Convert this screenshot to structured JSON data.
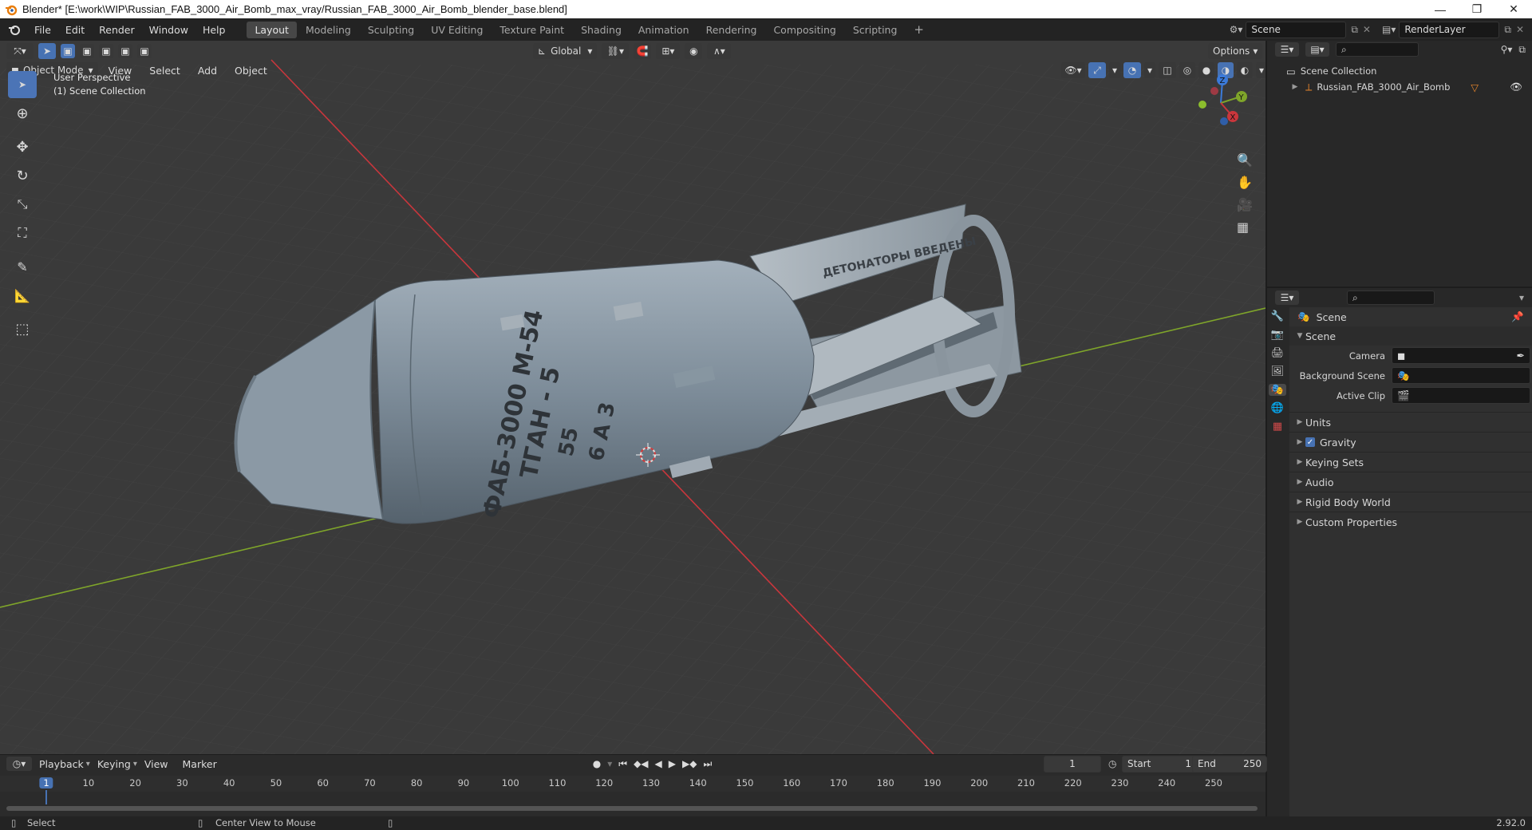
{
  "window": {
    "title": "Blender* [E:\\work\\WIP\\Russian_FAB_3000_Air_Bomb_max_vray/Russian_FAB_3000_Air_Bomb_blender_base.blend]",
    "minimize": "—",
    "maximize": "❐",
    "close": "✕"
  },
  "menu": [
    "File",
    "Edit",
    "Render",
    "Window",
    "Help"
  ],
  "workspaces": [
    "Layout",
    "Modeling",
    "Sculpting",
    "UV Editing",
    "Texture Paint",
    "Shading",
    "Animation",
    "Rendering",
    "Compositing",
    "Scripting"
  ],
  "add_workspace": "+",
  "scene_field": "Scene",
  "renderlayer_field": "RenderLayer",
  "viewport": {
    "mode": "Object Mode",
    "view_menu": "View",
    "select_menu": "Select",
    "add_menu": "Add",
    "object_menu": "Object",
    "orientation": "Global",
    "options": "Options",
    "overlay_line1": "User Perspective",
    "overlay_line2": "(1) Scene Collection",
    "gizmo": {
      "z": "Z",
      "y": "Y",
      "x": "X"
    },
    "model_text": {
      "line1": "ФАБ-3000 М-54",
      "line2": "ТГАН - 5",
      "line3": "55",
      "line4": "6 А 3",
      "tail": "ДЕТОНАТОРЫ ВВЕДЕНЫ"
    }
  },
  "timeline": {
    "menus": [
      "Playback",
      "Keying",
      "View",
      "Marker"
    ],
    "current_frame": "1",
    "start_label": "Start",
    "start_value": "1",
    "end_label": "End",
    "end_value": "250",
    "ruler": [
      "1",
      "10",
      "20",
      "30",
      "40",
      "50",
      "60",
      "70",
      "80",
      "90",
      "100",
      "110",
      "120",
      "130",
      "140",
      "150",
      "160",
      "170",
      "180",
      "190",
      "200",
      "210",
      "220",
      "230",
      "240",
      "250"
    ]
  },
  "status": {
    "select": "Select",
    "center": "Center View to Mouse",
    "version": "2.92.0"
  },
  "outliner": {
    "root": "Scene Collection",
    "item": "Russian_FAB_3000_Air_Bomb"
  },
  "properties": {
    "breadcrumb": "Scene",
    "section": "Scene",
    "fields": [
      {
        "label": "Camera"
      },
      {
        "label": "Background Scene"
      },
      {
        "label": "Active Clip"
      }
    ],
    "panels": [
      "Units",
      "Gravity",
      "Keying Sets",
      "Audio",
      "Rigid Body World",
      "Custom Properties"
    ],
    "gravity_checked": true
  },
  "colors": {
    "accent": "#4772b3",
    "x_axis": "#c9363c",
    "y_axis": "#7fa52a",
    "bg_viewport": "#393939"
  }
}
